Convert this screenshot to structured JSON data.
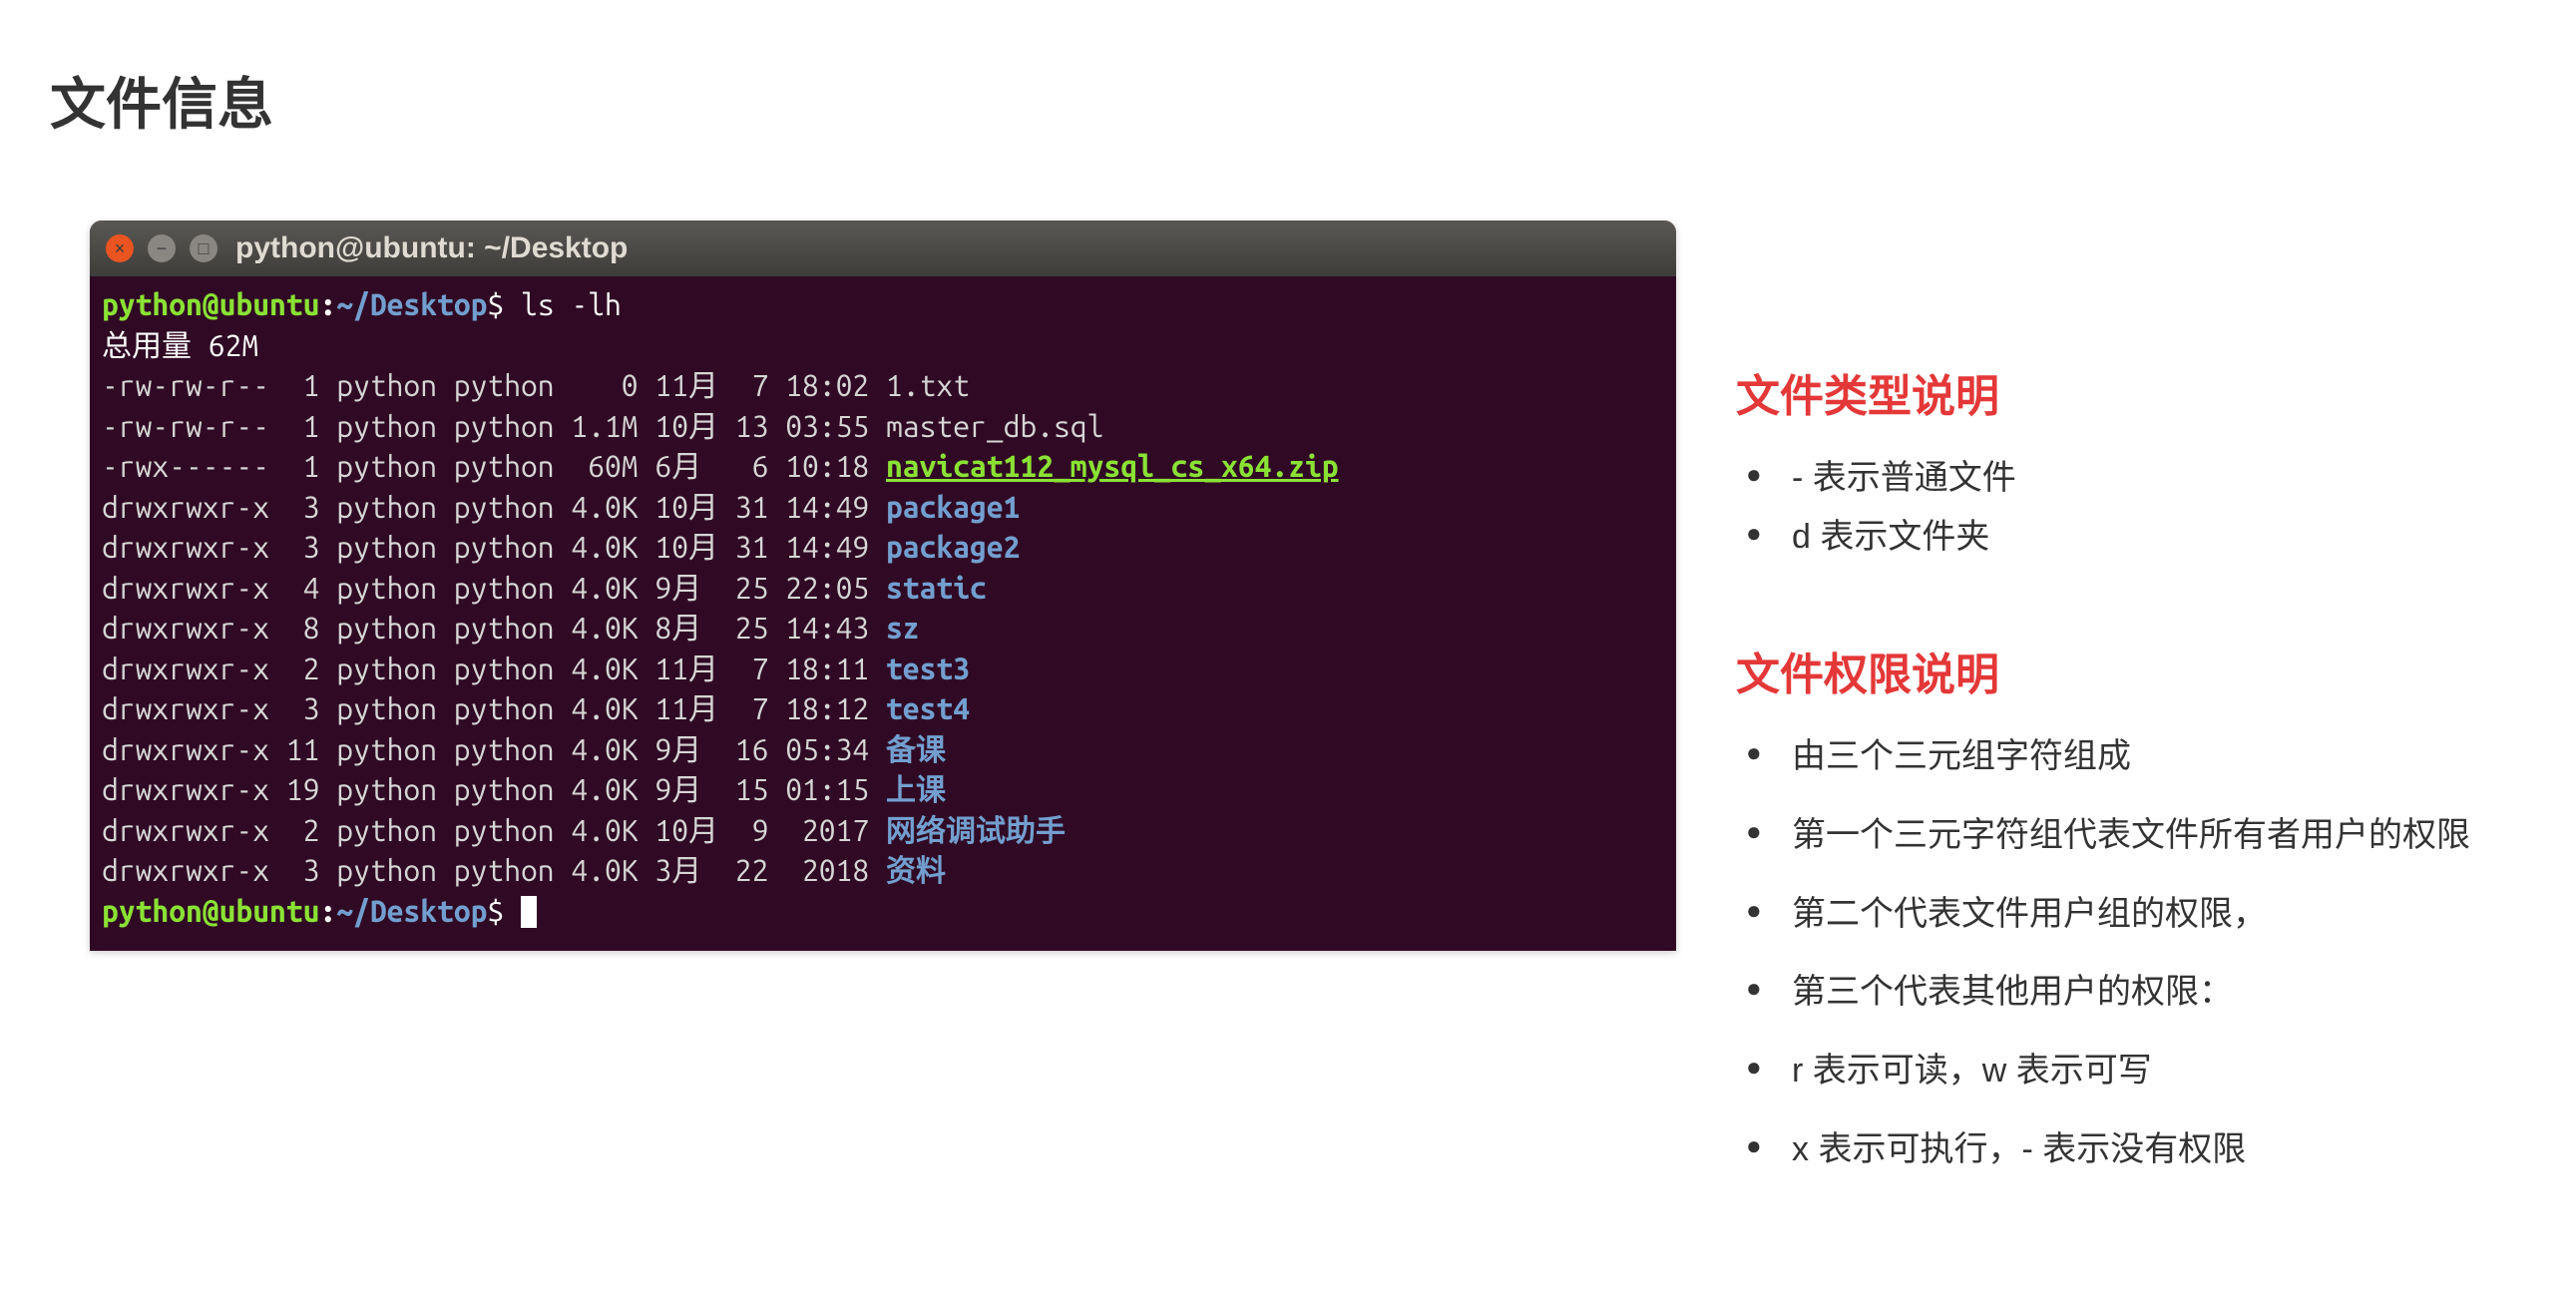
{
  "page_title": "文件信息",
  "terminal": {
    "window_title": "python@ubuntu: ~/Desktop",
    "prompt_user": "python@ubuntu",
    "prompt_path": "~/Desktop",
    "command": "ls -lh",
    "total_line": "总用量 62M",
    "rows": [
      {
        "perm": "-rw-rw-r--",
        "links": "1",
        "owner": "python",
        "group": "python",
        "size": "0",
        "month": "11月",
        "day": "7",
        "time": "18:02",
        "name": "1.txt",
        "kind": "plain"
      },
      {
        "perm": "-rw-rw-r--",
        "links": "1",
        "owner": "python",
        "group": "python",
        "size": "1.1M",
        "month": "10月",
        "day": "13",
        "time": "03:55",
        "name": "master_db.sql",
        "kind": "plain"
      },
      {
        "perm": "-rwx------",
        "links": "1",
        "owner": "python",
        "group": "python",
        "size": "60M",
        "month": "6月",
        "day": "6",
        "time": "10:18",
        "name": "navicat112_mysql_cs_x64.zip",
        "kind": "zip"
      },
      {
        "perm": "drwxrwxr-x",
        "links": "3",
        "owner": "python",
        "group": "python",
        "size": "4.0K",
        "month": "10月",
        "day": "31",
        "time": "14:49",
        "name": "package1",
        "kind": "dir"
      },
      {
        "perm": "drwxrwxr-x",
        "links": "3",
        "owner": "python",
        "group": "python",
        "size": "4.0K",
        "month": "10月",
        "day": "31",
        "time": "14:49",
        "name": "package2",
        "kind": "dir"
      },
      {
        "perm": "drwxrwxr-x",
        "links": "4",
        "owner": "python",
        "group": "python",
        "size": "4.0K",
        "month": "9月",
        "day": "25",
        "time": "22:05",
        "name": "static",
        "kind": "dir"
      },
      {
        "perm": "drwxrwxr-x",
        "links": "8",
        "owner": "python",
        "group": "python",
        "size": "4.0K",
        "month": "8月",
        "day": "25",
        "time": "14:43",
        "name": "sz",
        "kind": "dir"
      },
      {
        "perm": "drwxrwxr-x",
        "links": "2",
        "owner": "python",
        "group": "python",
        "size": "4.0K",
        "month": "11月",
        "day": "7",
        "time": "18:11",
        "name": "test3",
        "kind": "dir"
      },
      {
        "perm": "drwxrwxr-x",
        "links": "3",
        "owner": "python",
        "group": "python",
        "size": "4.0K",
        "month": "11月",
        "day": "7",
        "time": "18:12",
        "name": "test4",
        "kind": "dir"
      },
      {
        "perm": "drwxrwxr-x",
        "links": "11",
        "owner": "python",
        "group": "python",
        "size": "4.0K",
        "month": "9月",
        "day": "16",
        "time": "05:34",
        "name": "备课",
        "kind": "dir"
      },
      {
        "perm": "drwxrwxr-x",
        "links": "19",
        "owner": "python",
        "group": "python",
        "size": "4.0K",
        "month": "9月",
        "day": "15",
        "time": "01:15",
        "name": "上课",
        "kind": "dir"
      },
      {
        "perm": "drwxrwxr-x",
        "links": "2",
        "owner": "python",
        "group": "python",
        "size": "4.0K",
        "month": "10月",
        "day": "9",
        "time": "2017",
        "name": "网络调试助手",
        "kind": "dir"
      },
      {
        "perm": "drwxrwxr-x",
        "links": "3",
        "owner": "python",
        "group": "python",
        "size": "4.0K",
        "month": "3月",
        "day": "22",
        "time": "2018",
        "name": "资料",
        "kind": "dir"
      }
    ]
  },
  "sections": {
    "file_type": {
      "heading": "文件类型说明",
      "items": [
        "- 表示普通文件",
        "d 表示文件夹"
      ]
    },
    "file_perm": {
      "heading": "文件权限说明",
      "items": [
        "由三个三元组字符组成",
        "第一个三元字符组代表文件所有者用户的权限",
        "第二个代表文件用户组的权限，",
        "第三个代表其他用户的权限：",
        "r 表示可读，w 表示可写",
        "x 表示可执行，- 表示没有权限"
      ]
    }
  }
}
